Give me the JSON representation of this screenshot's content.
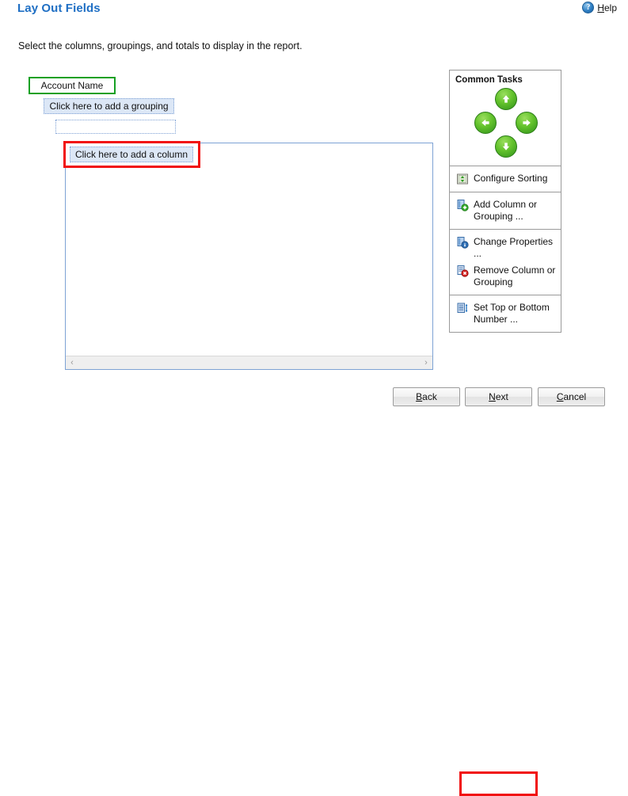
{
  "header": {
    "title": "Lay Out Fields",
    "help_label_pre": "H",
    "help_label_post": "elp",
    "help_icon": "question-mark-circle-icon"
  },
  "subtitle": "Select the columns, groupings, and totals to display in the report.",
  "design": {
    "account_name_field": "Account Name",
    "grouping_placeholder": "Click here to add a grouping",
    "grouping_empty_row": "",
    "column_placeholder": "Click here to add a column",
    "scrollbar": {
      "left_arrow": "‹",
      "right_arrow": "›"
    }
  },
  "common_tasks": {
    "title": "Common Tasks",
    "nav_arrows": [
      {
        "name": "move-up",
        "icon": "arrow-up-icon"
      },
      {
        "name": "move-left",
        "icon": "arrow-left-icon"
      },
      {
        "name": "move-right",
        "icon": "arrow-right-icon"
      },
      {
        "name": "move-down",
        "icon": "arrow-down-icon"
      }
    ],
    "groups": [
      {
        "items": [
          {
            "label": "Configure Sorting",
            "icon": "sort-icon"
          }
        ]
      },
      {
        "items": [
          {
            "label": "Add Column or Grouping ...",
            "icon": "add-column-icon"
          }
        ]
      },
      {
        "items": [
          {
            "label": "Change Properties ...",
            "icon": "properties-icon"
          },
          {
            "label": "Remove Column or Grouping",
            "icon": "remove-column-icon"
          }
        ]
      },
      {
        "items": [
          {
            "label": "Set Top or Bottom Number ...",
            "icon": "top-bottom-icon"
          }
        ]
      }
    ]
  },
  "footer": {
    "back": {
      "accel": "B",
      "rest": "ack"
    },
    "next": {
      "accel": "N",
      "rest": "ext"
    },
    "cancel": {
      "accel": "C",
      "rest": "ancel"
    }
  },
  "colors": {
    "title_blue": "#1f6fc4",
    "highlight_red": "#f10f0f",
    "highlight_green": "#16a024",
    "placeholder_blue_fill": "#dce7f6",
    "placeholder_blue_border": "#7b9fd4",
    "panel_border_blue": "#7da2d4",
    "arrow_green": "#63c22c"
  }
}
